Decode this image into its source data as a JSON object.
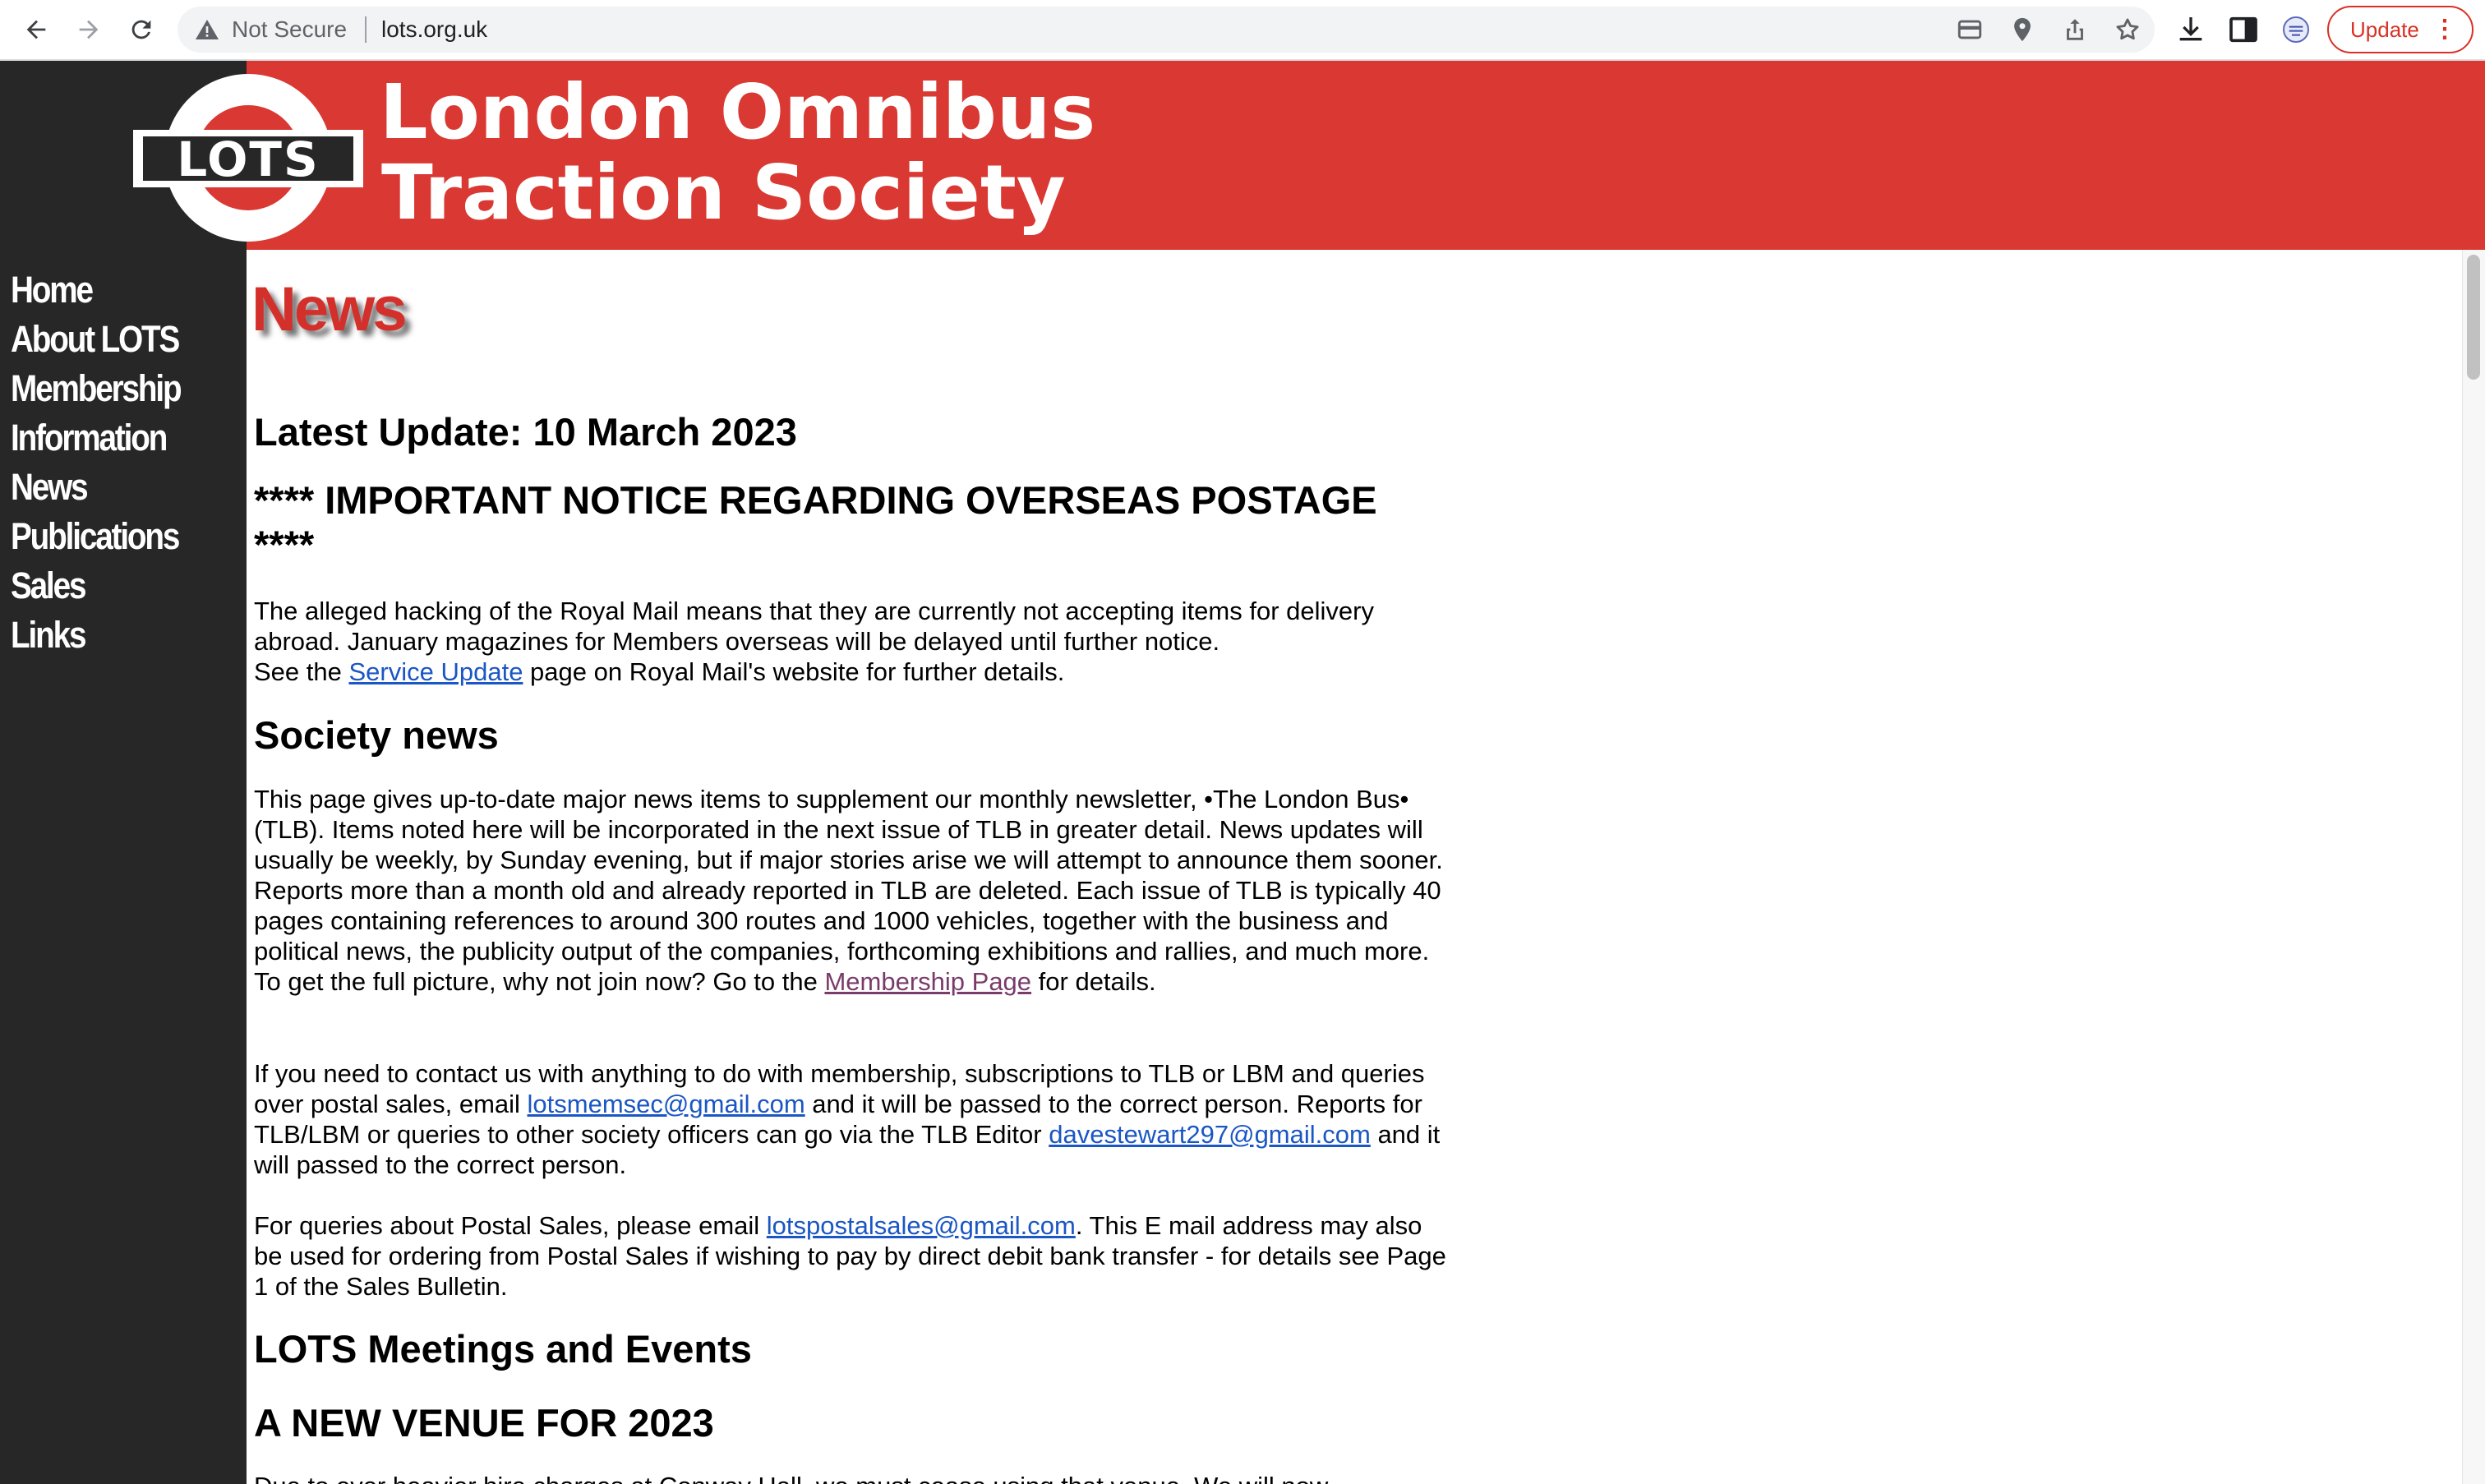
{
  "browser": {
    "security_label": "Not Secure",
    "url": "lots.org.uk",
    "update_label": "Update",
    "update_menu_glyph": "⋮",
    "toolbar_icons": [
      "back-icon",
      "forward-icon",
      "reload-icon",
      "warning-icon",
      "card-icon",
      "location-pin-icon",
      "share-icon",
      "star-icon",
      "download-icon",
      "side-panel-icon",
      "extension-icon"
    ]
  },
  "banner": {
    "logo_text": "LOTS",
    "title_line1": "London Omnibus",
    "title_line2": "Traction Society",
    "colors": {
      "red": "#da3832",
      "dark": "#272727"
    }
  },
  "sidebar": {
    "items": [
      {
        "label": "Home"
      },
      {
        "label": "About LOTS"
      },
      {
        "label": "Membership"
      },
      {
        "label": "Information"
      },
      {
        "label": "News"
      },
      {
        "label": "Publications"
      },
      {
        "label": "Sales"
      },
      {
        "label": "Links"
      }
    ]
  },
  "main": {
    "page_title": "News",
    "latest_update": "Latest Update: 10 March 2023",
    "notice_heading": "**** IMPORTANT NOTICE REGARDING OVERSEAS POSTAGE ****",
    "notice_text": "The alleged hacking of the Royal Mail means that they are currently not accepting items for delivery abroad. January magazines for Members overseas will be delayed until further notice.",
    "notice_see_prefix": "See the ",
    "notice_link": "Service Update",
    "notice_see_suffix": " page on Royal Mail's website for further details.",
    "society_heading": "Society news",
    "society_text": "This page gives up-to-date major news items to supplement our monthly newsletter, •The London Bus• (TLB). Items noted here will be incorporated in the next issue of TLB in greater detail. News updates will usually be weekly, by Sunday evening, but if major stories arise we will attempt to announce them sooner. Reports more than a month old and already reported in TLB are deleted. Each issue of TLB is typically 40 pages containing references to around 300 routes and 1000 vehicles, together with the business and political news, the publicity output of the companies, forthcoming exhibitions and rallies, and much more. To get the full picture, why not join now? Go to the ",
    "membership_link": "Membership Page",
    "society_text_suffix": " for details.",
    "contact_text_1": "If you need to contact us with anything to do with membership, subscriptions to TLB or LBM and queries over postal sales, email ",
    "contact_email_1": "lotsmemsec@gmail.com",
    "contact_text_2": " and it will be passed to the correct person. Reports for TLB/LBM or queries to other society officers can go via the TLB Editor ",
    "contact_email_2": "davestewart297@gmail.com",
    "contact_text_3": " and it will passed to the correct person.",
    "postal_text_1": "For queries about Postal Sales, please email ",
    "postal_email": "lotspostalsales@gmail.com",
    "postal_text_2": ". This E mail address may also be used for ordering from Postal Sales if wishing to pay by direct debit bank transfer - for details see Page 1 of the Sales Bulletin.",
    "meetings_heading": "LOTS Meetings and Events",
    "venue_heading": "A NEW VENUE FOR 2023",
    "venue_text_partial": "Due to ever heavier hire charges at Conway Hall, we must cease using that venue. We will now"
  }
}
